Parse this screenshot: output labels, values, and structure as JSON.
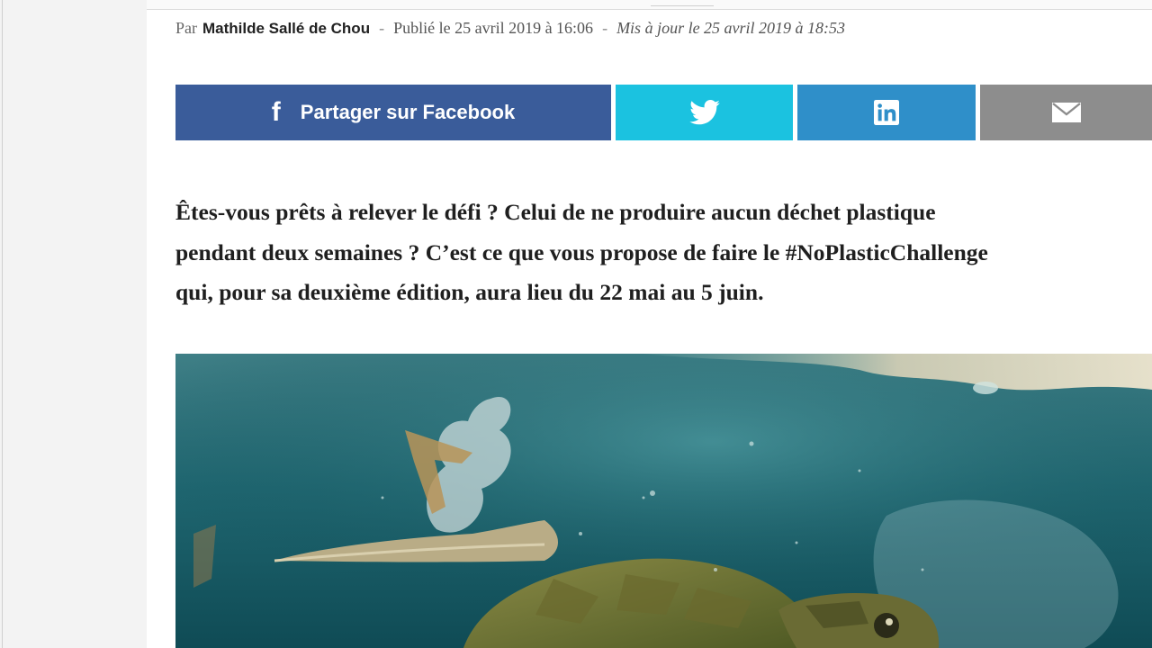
{
  "byline": {
    "prefix": "Par",
    "author": "Mathilde Sallé de Chou",
    "separator": "-",
    "published": "Publié le 25 avril 2019 à 16:06",
    "separator2": "-",
    "updated": "Mis à jour le 25 avril 2019 à 18:53"
  },
  "share": {
    "facebook_label": "Partager sur Facebook",
    "facebook_icon": "facebook-icon",
    "twitter_icon": "twitter-icon",
    "linkedin_icon": "linkedin-icon",
    "email_icon": "mail-icon",
    "colors": {
      "facebook": "#3a5c9a",
      "twitter": "#1bc2e0",
      "linkedin": "#2f8fc9",
      "email": "#8d8d8d"
    }
  },
  "lead": {
    "lines": [
      "Êtes-vous prêts à relever le défi ? Celui de ne produire aucun déchet plastique",
      "pendant deux semaines ? C’est ce que vous propose de faire le #NoPlasticChallenge",
      "qui, pour sa deuxième édition, aura lieu du 22 mai au 5 juin."
    ]
  },
  "image": {
    "subject": "sea-turtle-underwater-with-plastic"
  }
}
